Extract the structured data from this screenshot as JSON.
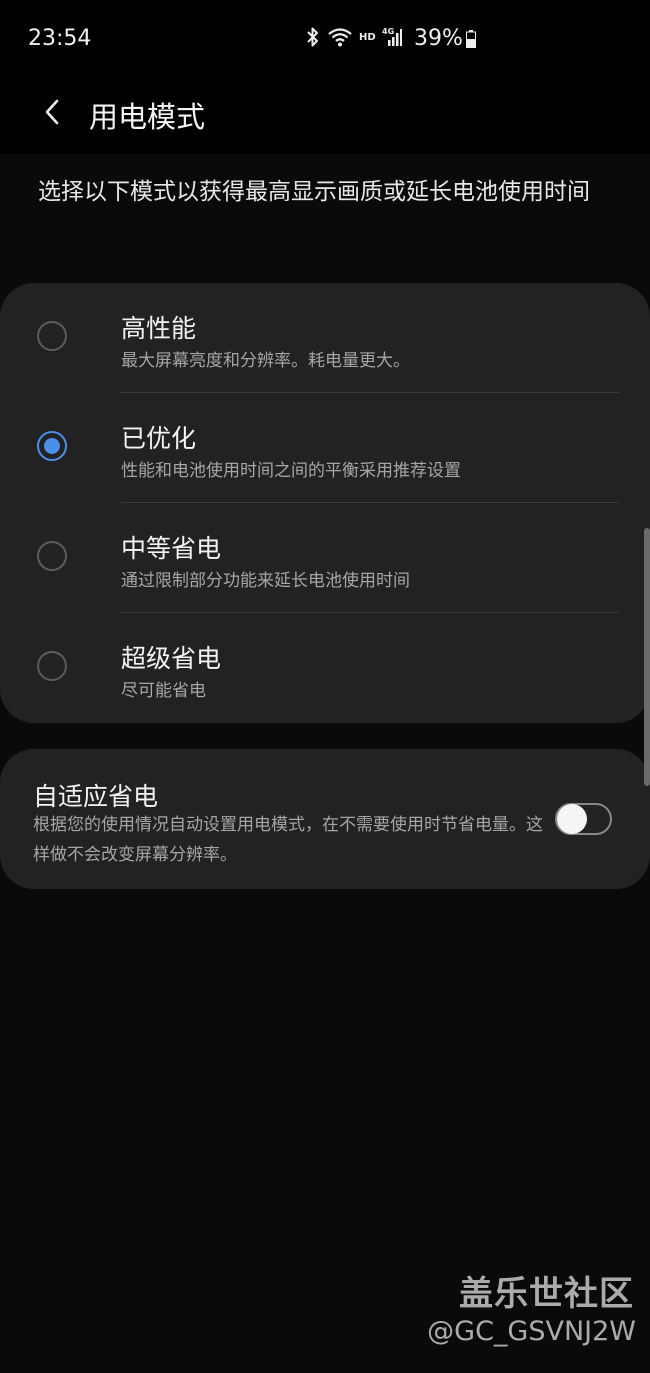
{
  "status_bar": {
    "time": "23:54",
    "hd_label": "HD",
    "network_label": "4G",
    "battery": "39%",
    "icons": [
      "bluetooth-icon",
      "wifi-icon",
      "hd-icon",
      "signal-4g-icon",
      "battery-icon"
    ]
  },
  "app_bar": {
    "title": "用电模式",
    "back_icon": "chevron-left-icon"
  },
  "description": "选择以下模式以获得最高显示画质或延长电池使用时间",
  "modes": [
    {
      "title": "高性能",
      "desc": "最大屏幕亮度和分辨率。耗电量更大。",
      "selected": false
    },
    {
      "title": "已优化",
      "desc": "性能和电池使用时间之间的平衡采用推荐设置",
      "selected": true
    },
    {
      "title": "中等省电",
      "desc": "通过限制部分功能来延长电池使用时间",
      "selected": false
    },
    {
      "title": "超级省电",
      "desc": "尽可能省电",
      "selected": false
    }
  ],
  "adaptive": {
    "title": "自适应省电",
    "desc": "根据您的使用情况自动设置用电模式，在不需要使用时节省电量。这样做不会改变屏幕分辨率。",
    "enabled": false
  },
  "watermark": {
    "site": "盖乐世社区",
    "user": "@GC_GSVNJ2W"
  },
  "colors": {
    "accent": "#4a90e8",
    "card_bg": "#222222",
    "page_bg": "#0a0a0a"
  }
}
